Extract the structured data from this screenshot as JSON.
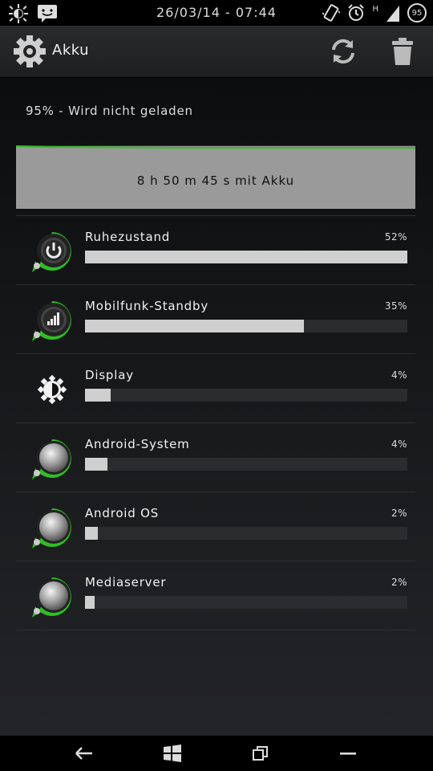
{
  "status_bar": {
    "datetime": "26/03/14 - 07:44",
    "battery_level": "95",
    "network_type": "H"
  },
  "action_bar": {
    "title": "Akku"
  },
  "battery_status": "95% - Wird nicht geladen",
  "graph_label": "8 h 50 m 45 s mit Akku",
  "usage": [
    {
      "name": "Ruhezustand",
      "percent_label": "52%",
      "percent": 52,
      "icon": "power-icon"
    },
    {
      "name": "Mobilfunk-Standby",
      "percent_label": "35%",
      "percent": 35,
      "icon": "signal-icon"
    },
    {
      "name": "Display",
      "percent_label": "4%",
      "percent": 4,
      "icon": "brightness-icon"
    },
    {
      "name": "Android-System",
      "percent_label": "4%",
      "percent": 4,
      "icon": "android-system-icon"
    },
    {
      "name": "Android OS",
      "percent_label": "2%",
      "percent": 2,
      "icon": "android-os-icon"
    },
    {
      "name": "Mediaserver",
      "percent_label": "2%",
      "percent": 2,
      "icon": "mediaserver-icon"
    }
  ],
  "bar_fill_fractions": [
    1.0,
    0.68,
    0.08,
    0.07,
    0.04,
    0.03
  ],
  "colors": {
    "accent_green": "#2fbf24",
    "bar_fill": "#cfcfcf",
    "graph_bg": "#9a9a9a"
  }
}
